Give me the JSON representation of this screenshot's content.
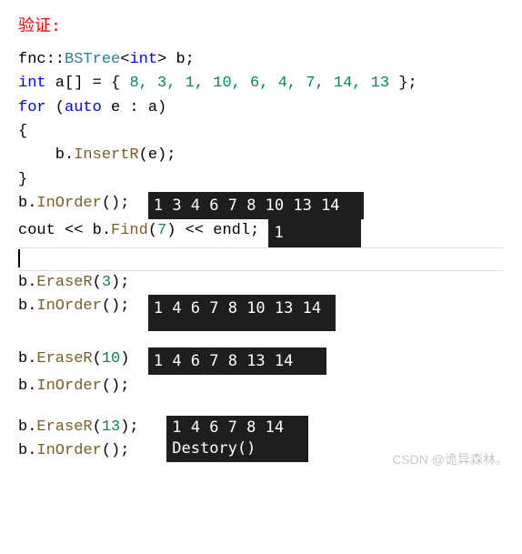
{
  "title": "验证:",
  "code": {
    "l1_a": "fnc::",
    "l1_b": "BSTree",
    "l1_c": "<",
    "l1_d": "int",
    "l1_e": "> b;",
    "l2_a": "int",
    "l2_b": " a[] = { ",
    "l2_nums": "8, 3, 1, 10, 6, 4, 7, 14, 13",
    "l2_c": " };",
    "l3_a": "for",
    "l3_b": " (",
    "l3_c": "auto",
    "l3_d": " e : a)",
    "l4": "{",
    "l5_a": "    b.",
    "l5_b": "InsertR",
    "l5_c": "(e);",
    "l6": "}",
    "l7_a": "b.",
    "l7_b": "InOrder",
    "l7_c": "();  ",
    "l8_a": "cout << b.",
    "l8_b": "Find",
    "l8_c": "(",
    "l8_n": "7",
    "l8_d": ") << endl; ",
    "l9_a": "b.",
    "l9_b": "EraseR",
    "l9_c": "(",
    "l9_n": "3",
    "l9_d": ");",
    "l10_a": "b.",
    "l10_b": "InOrder",
    "l10_c": "();  ",
    "l11_a": "b.",
    "l11_b": "EraseR",
    "l11_c": "(",
    "l11_n": "10",
    "l11_d": ")  ",
    "l12_a": "b.",
    "l12_b": "InOrder",
    "l12_c": "();",
    "l13_a": "b.",
    "l13_b": "EraseR",
    "l13_c": "(",
    "l13_n": "13",
    "l13_d": ");   ",
    "l14_a": "b.",
    "l14_b": "InOrder",
    "l14_c": "();"
  },
  "output": {
    "o1": "1 3 4 6 7 8 10 13 14  ",
    "o2": "1",
    "o3": "1 4 6 7 8 10 13 14 ",
    "o4": "1 4 6 7 8 13 14   ",
    "o5": "1 4 6 7 8 14  \nDestory()    "
  },
  "watermark": "CSDN @诡异森林。"
}
